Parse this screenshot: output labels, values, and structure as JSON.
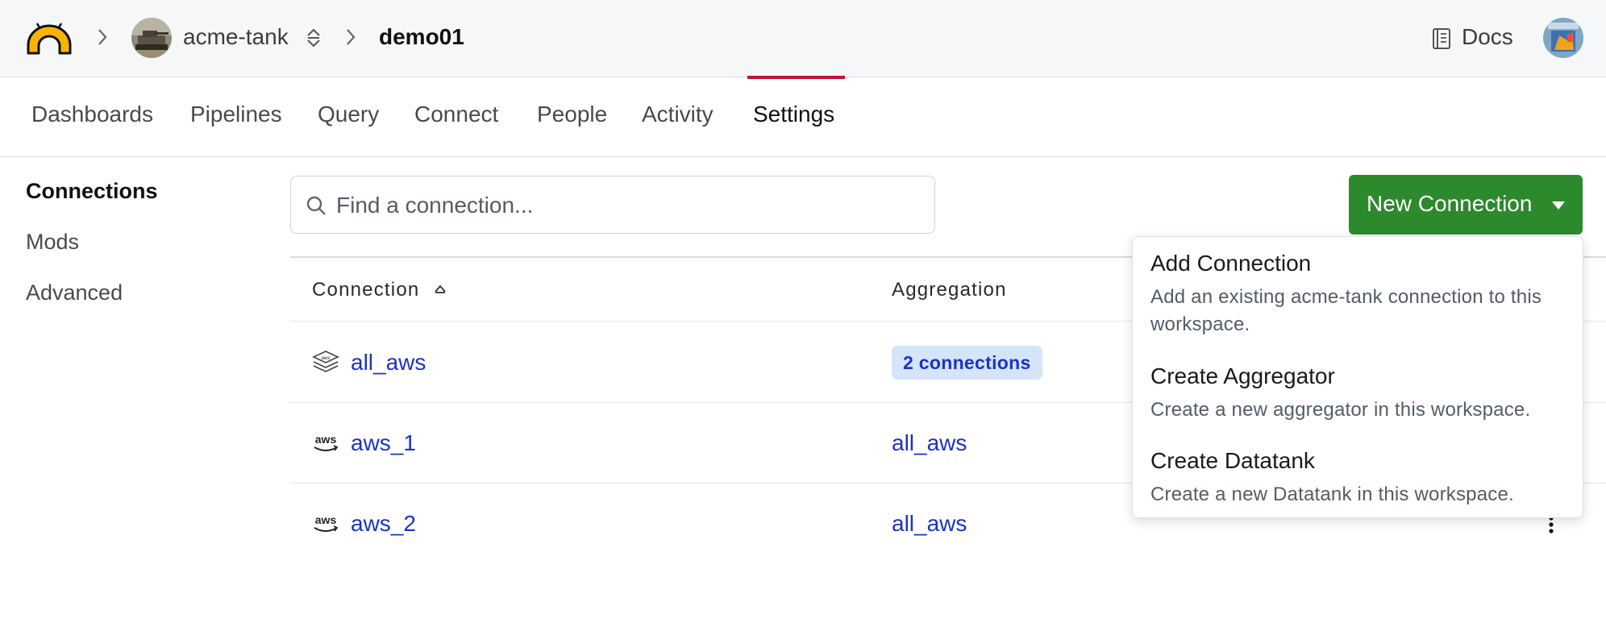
{
  "topbar": {
    "workspace_owner": "acme-tank",
    "workspace": "demo01",
    "docs_label": "Docs"
  },
  "tabs": [
    {
      "label": "Dashboards",
      "active": false
    },
    {
      "label": "Pipelines",
      "active": false
    },
    {
      "label": "Query",
      "active": false
    },
    {
      "label": "Connect",
      "active": false
    },
    {
      "label": "People",
      "active": false
    },
    {
      "label": "Activity",
      "active": false
    },
    {
      "label": "Settings",
      "active": true
    }
  ],
  "sidebar": {
    "items": [
      {
        "label": "Connections",
        "active": true
      },
      {
        "label": "Mods",
        "active": false
      },
      {
        "label": "Advanced",
        "active": false
      }
    ]
  },
  "search": {
    "placeholder": "Find a connection..."
  },
  "new_connection_button": {
    "label": "New Connection"
  },
  "table": {
    "columns": [
      "Connection",
      "Aggregation"
    ],
    "sort_column": "Connection",
    "rows": [
      {
        "icon": "aggregator-icon",
        "name": "all_aws",
        "aggregation": "2 connections",
        "aggregation_kind": "badge"
      },
      {
        "icon": "aws-icon",
        "name": "aws_1",
        "aggregation": "all_aws",
        "aggregation_kind": "link"
      },
      {
        "icon": "aws-icon",
        "name": "aws_2",
        "aggregation": "all_aws",
        "aggregation_kind": "link"
      }
    ]
  },
  "dropdown": {
    "items": [
      {
        "title": "Add Connection",
        "description": "Add an existing acme-tank connection to this workspace."
      },
      {
        "title": "Create Aggregator",
        "description": "Create a new aggregator in this workspace."
      },
      {
        "title": "Create Datatank",
        "description": "Create a new Datatank in this workspace."
      }
    ]
  },
  "colors": {
    "primary_button": "#2c8a2c",
    "link": "#1a32c9",
    "active_tab_underline": "#c8102e",
    "badge_bg": "#d6e4fb"
  }
}
